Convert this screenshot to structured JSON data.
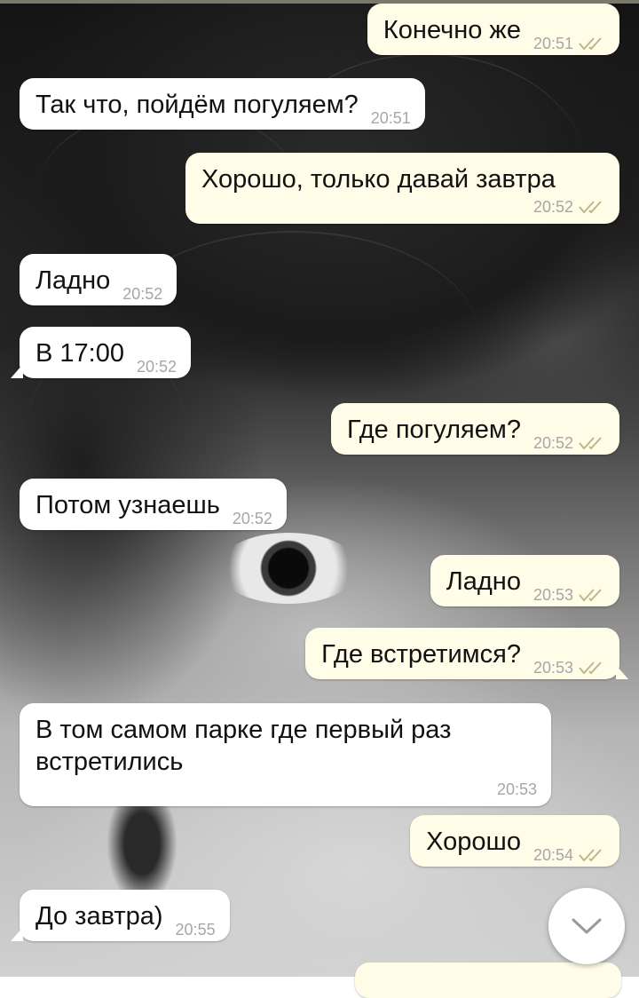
{
  "messages": [
    {
      "id": "m1",
      "dir": "out",
      "text": "Конечно же",
      "time": "20:51",
      "read": true
    },
    {
      "id": "m2",
      "dir": "in",
      "text": "Так что, пойдём погуляем?",
      "time": "20:51"
    },
    {
      "id": "m3",
      "dir": "out",
      "text": "Хорошо, только давай завтра",
      "time": "20:52",
      "read": true
    },
    {
      "id": "m4",
      "dir": "in",
      "text": "Ладно",
      "time": "20:52"
    },
    {
      "id": "m5",
      "dir": "in",
      "text": "В 17:00",
      "time": "20:52"
    },
    {
      "id": "m6",
      "dir": "out",
      "text": "Где погуляем?",
      "time": "20:52",
      "read": true
    },
    {
      "id": "m7",
      "dir": "in",
      "text": "Потом узнаешь",
      "time": "20:52"
    },
    {
      "id": "m8",
      "dir": "out",
      "text": "Ладно",
      "time": "20:53",
      "read": true
    },
    {
      "id": "m9",
      "dir": "out",
      "text": "Где встретимся?",
      "time": "20:53",
      "read": true
    },
    {
      "id": "m10",
      "dir": "in",
      "text": "В том самом парке где первый раз встретились",
      "time": "20:53"
    },
    {
      "id": "m11",
      "dir": "out",
      "text": "Хорошо",
      "time": "20:54",
      "read": true
    },
    {
      "id": "m12",
      "dir": "in",
      "text": "До завтра)",
      "time": "20:55"
    }
  ],
  "scroll_button": {
    "icon": "chevron-down-icon"
  },
  "colors": {
    "incoming_bubble": "#ffffff",
    "outgoing_bubble": "#fffde8",
    "time_text": "#a6a6a6",
    "read_check": "#b9b98a"
  }
}
